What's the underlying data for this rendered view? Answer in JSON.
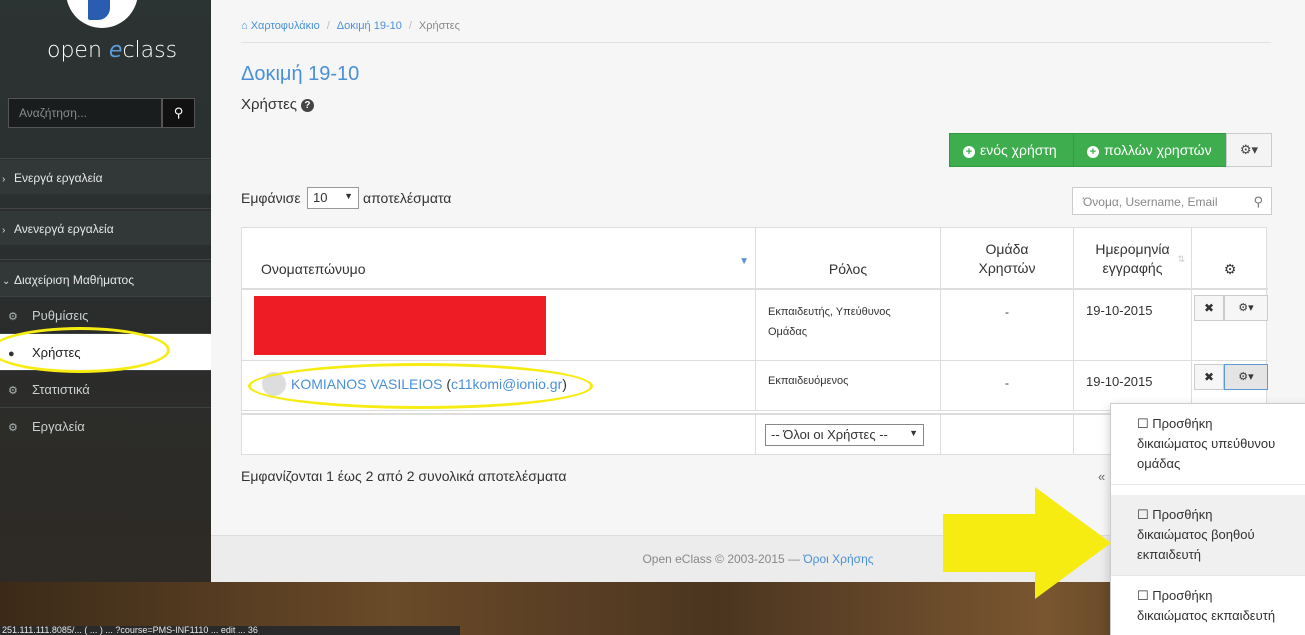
{
  "sidebar": {
    "logo_text_open": "open ",
    "logo_text_e": "e",
    "logo_text_class": "class",
    "search_placeholder": "Αναζήτηση...",
    "groups": [
      {
        "label": "Ενεργά εργαλεία"
      },
      {
        "label": "Ανενεργά εργαλεία"
      },
      {
        "label": "Διαχείριση Μαθήματος"
      }
    ],
    "items": [
      {
        "label": "Ρυθμίσεις"
      },
      {
        "label": "Χρήστες"
      },
      {
        "label": "Στατιστικά"
      },
      {
        "label": "Εργαλεία"
      }
    ]
  },
  "breadcrumb": [
    "Χαρτοφυλάκιο",
    "Δοκιμή 19-10",
    "Χρήστες"
  ],
  "course_title": "Δοκιμή 19-10",
  "page_subtitle": "Χρήστες",
  "toolbar": {
    "add_one_user": "ενός χρήστη",
    "add_many_users": "πολλών χρηστών"
  },
  "table_controls": {
    "show_prefix": "Εμφάνισε",
    "page_size": "10",
    "show_suffix": "αποτελέσματα",
    "search_placeholder": "Όνομα, Username, Email"
  },
  "table": {
    "headers": {
      "name": "Ονοματεπώνυμο",
      "role": "Ρόλος",
      "group_line1": "Ομάδα",
      "group_line2": "Χρηστών",
      "date_line1": "Ημερομηνία",
      "date_line2": "εγγραφής"
    },
    "rows": [
      {
        "name": "",
        "role_line1": "Εκπαιδευτής, Υπεύθυνος",
        "role_line2": "Ομάδας",
        "group": "-",
        "date": "19-10-2015"
      },
      {
        "name": "KOMIANOS VASILEIOS",
        "email": "c11komi@ionio.gr",
        "role_line1": "Εκπαιδευόμενος",
        "role_line2": "",
        "group": "-",
        "date": "19-10-2015"
      }
    ],
    "filter_value": "-- Όλοι οι Χρήστες --"
  },
  "results_text": "Εμφανίζονται 1 έως 2 από 2 συνολικά αποτελέσματα",
  "pager_prev": "«",
  "footer": {
    "text": "Open eClass © 2003-2015 — ",
    "terms_link": "Όροι Χρήσης"
  },
  "dropdown_menu": [
    {
      "line1": "☐ Προσθήκη",
      "line2": "δικαιώματος υπεύθυνου",
      "line3": "ομάδας"
    },
    {
      "line1": "☐ Προσθήκη",
      "line2": "δικαιώματος βοηθού",
      "line3": "εκπαιδευτή"
    },
    {
      "line1": "☐ Προσθήκη",
      "line2": "δικαιώματος εκπαιδευτή",
      "line3": ""
    }
  ],
  "status_bar_url": "251.111.111.8085/... ( ... ) ... ?course=PMS-INF1110 ... edit ... 36",
  "colors": {
    "accent": "#4a90d9",
    "success": "#3dad4d",
    "annotation": "#f7ec12",
    "redacted": "#ee1c24"
  }
}
